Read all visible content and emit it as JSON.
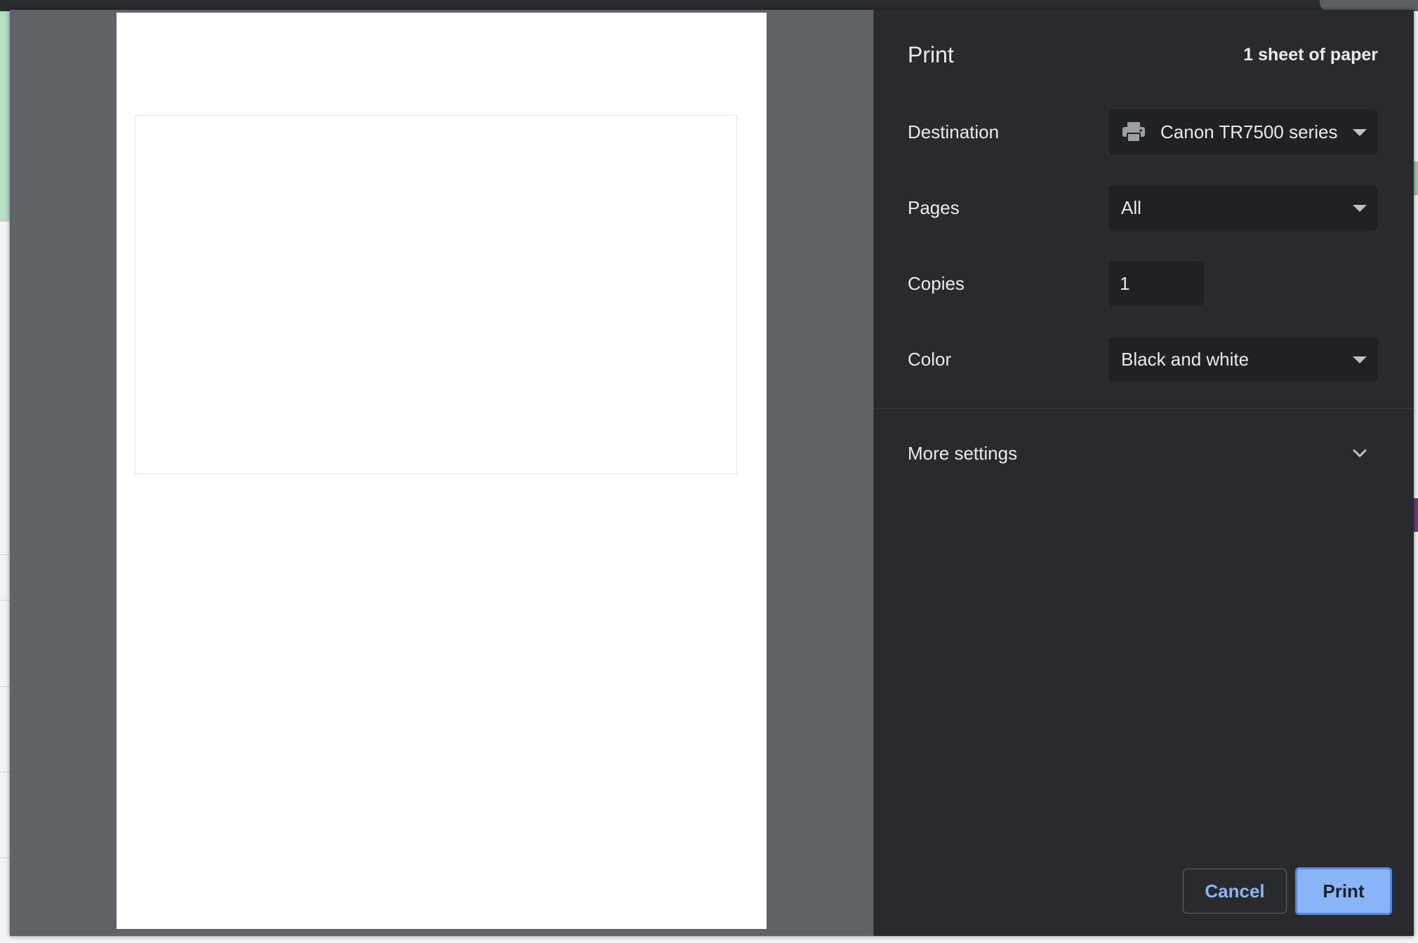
{
  "dialog": {
    "title": "Print",
    "sheet_count": "1 sheet of paper"
  },
  "settings": {
    "destination": {
      "label": "Destination",
      "value": "Canon TR7500 series",
      "icon": "printer-icon"
    },
    "pages": {
      "label": "Pages",
      "value": "All"
    },
    "copies": {
      "label": "Copies",
      "value": "1"
    },
    "color": {
      "label": "Color",
      "value": "Black and white"
    },
    "more_settings": {
      "label": "More settings",
      "icon": "chevron-down-icon"
    }
  },
  "actions": {
    "cancel_label": "Cancel",
    "print_label": "Print"
  },
  "colors": {
    "panel_bg": "#292a2d",
    "preview_bg": "#5f6368",
    "field_bg": "#202124",
    "accent": "#8ab4f8",
    "text": "#e8eaed"
  }
}
